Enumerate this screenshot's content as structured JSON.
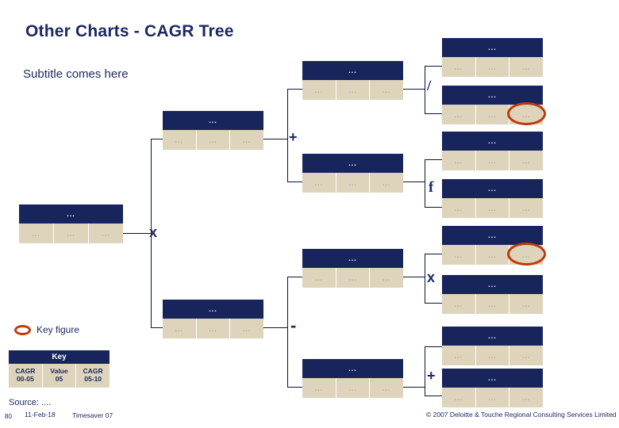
{
  "slide": {
    "title": "Other Charts - CAGR Tree",
    "subtitle": "Subtitle comes here"
  },
  "node_text": {
    "header": "...",
    "cell": "..."
  },
  "tree": {
    "nodes": [
      {
        "id": "root",
        "header": "...",
        "cells": [
          "...",
          "...",
          "..."
        ]
      },
      {
        "id": "l2-top",
        "header": "...",
        "cells": [
          "...",
          "...",
          "..."
        ]
      },
      {
        "id": "l2-bottom",
        "header": "...",
        "cells": [
          "...",
          "...",
          "..."
        ]
      },
      {
        "id": "l3-1",
        "header": "...",
        "cells": [
          "...",
          "...",
          "..."
        ]
      },
      {
        "id": "l3-2",
        "header": "...",
        "cells": [
          "...",
          "...",
          "..."
        ]
      },
      {
        "id": "l3-3",
        "header": "...",
        "cells": [
          "...",
          "...",
          "..."
        ]
      },
      {
        "id": "l3-4",
        "header": "...",
        "cells": [
          "...",
          "...",
          "..."
        ]
      },
      {
        "id": "l4-1",
        "header": "...",
        "cells": [
          "...",
          "...",
          "..."
        ]
      },
      {
        "id": "l4-2",
        "header": "...",
        "cells": [
          "...",
          "...",
          "..."
        ]
      },
      {
        "id": "l4-3",
        "header": "...",
        "cells": [
          "...",
          "...",
          "..."
        ]
      },
      {
        "id": "l4-4",
        "header": "...",
        "cells": [
          "...",
          "...",
          "..."
        ]
      },
      {
        "id": "l4-5",
        "header": "...",
        "cells": [
          "...",
          "...",
          "..."
        ]
      },
      {
        "id": "l4-6",
        "header": "...",
        "cells": [
          "...",
          "...",
          "..."
        ]
      },
      {
        "id": "l4-7",
        "header": "...",
        "cells": [
          "...",
          "...",
          "..."
        ]
      },
      {
        "id": "l4-8",
        "header": "...",
        "cells": [
          "...",
          "...",
          "..."
        ]
      }
    ],
    "operators": {
      "root": "x",
      "branch_top": "+",
      "branch_bottom": "-",
      "leaf_1": "/",
      "leaf_2": "f",
      "leaf_3": "x",
      "leaf_4": "+"
    }
  },
  "legend": {
    "key_figure_label": "Key figure",
    "key_header": "Key",
    "key_cells": [
      {
        "line1": "CAGR",
        "line2": "00-05"
      },
      {
        "line1": "Value",
        "line2": "05"
      },
      {
        "line1": "CAGR",
        "line2": "05-10"
      }
    ]
  },
  "footer": {
    "source": "Source: ....",
    "page_number": "80",
    "date": "11-Feb-18",
    "deck": "Timesaver 07",
    "copyright": "© 2007 Deloitte & Touche Regional Consulting Services Limited"
  },
  "colors": {
    "navy": "#17255c",
    "beige": "#ded4bc",
    "highlight": "#c0390b",
    "line": "#0d1333"
  }
}
